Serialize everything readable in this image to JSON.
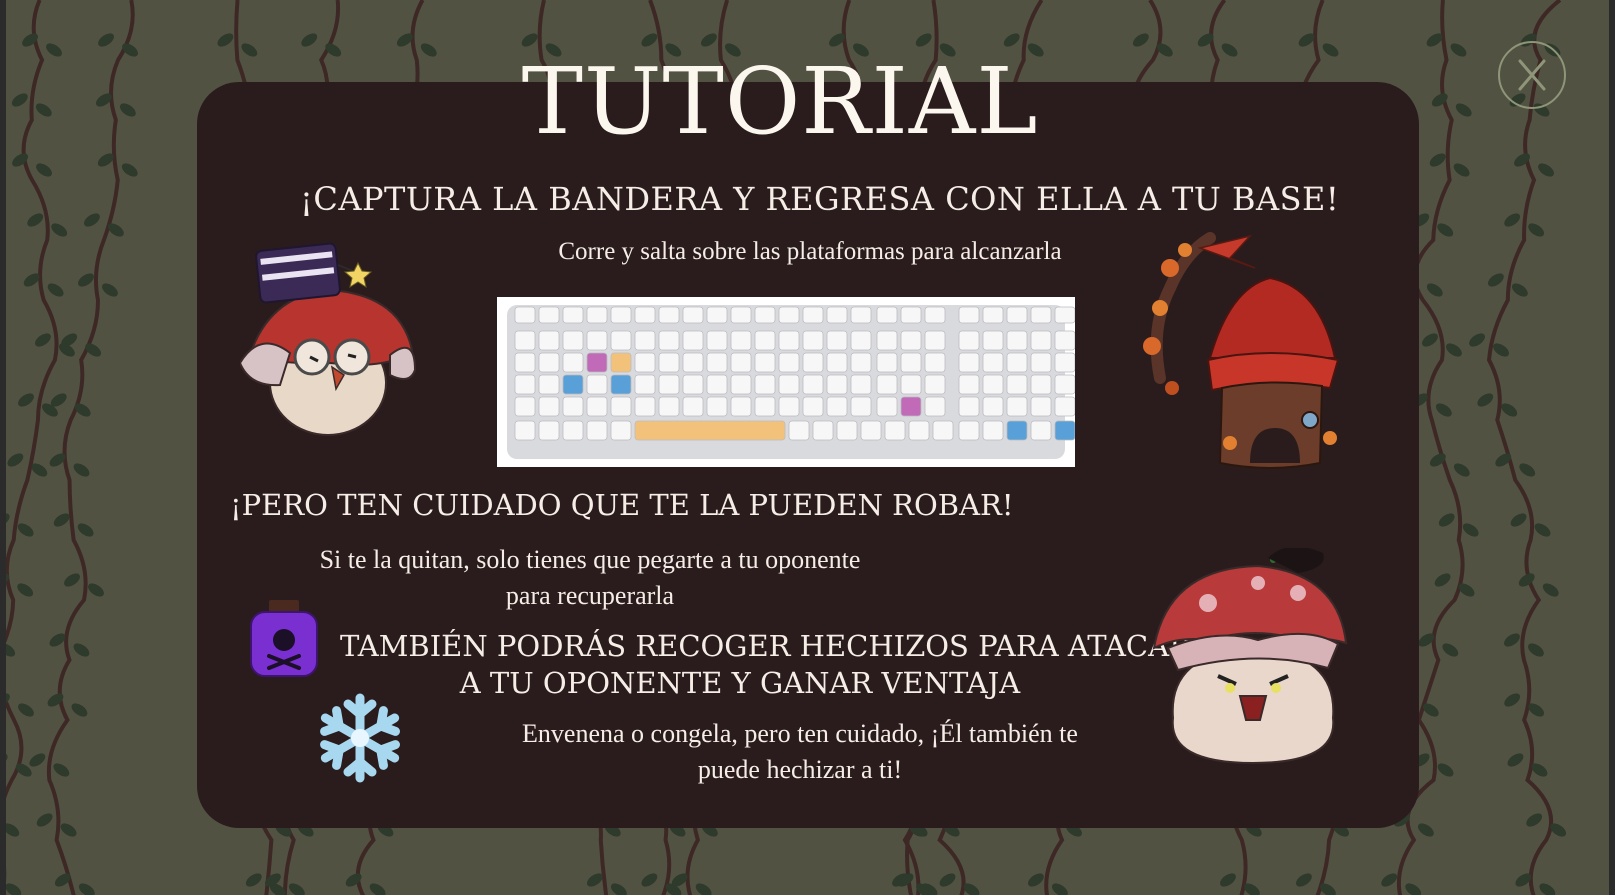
{
  "screen": {
    "title": "TUTORIAL",
    "heading_capture": "¡CAPTURA LA BANDERA Y REGRESA CON ELLA A TU BASE!",
    "text_capture": "Corre y salta sobre las plataformas para alcanzarla",
    "heading_steal": "¡PERO TEN CUIDADO QUE TE LA PUEDEN ROBAR!",
    "text_steal_line1": "Si te la quitan, solo tienes que pegarte a tu oponente",
    "text_steal_line2": "para recuperarla",
    "heading_spells_line1": "TAMBIÉN PODRÁS RECOGER HECHIZOS PARA ATACAR",
    "heading_spells_line2": "A TU OPONENTE Y GANAR VENTAJA",
    "text_spells_line1": "Envenena o congela, pero ten cuidado, ¡Él también te",
    "text_spells_line2": "puede hechizar a ti!"
  },
  "icons": {
    "close": "close-icon",
    "keyboard": "keyboard-diagram",
    "wizard": "mushroom-wizard-character",
    "base": "mushroom-house-base",
    "flag": "flag-branch",
    "poison": "poison-bottle-icon",
    "freeze": "snowflake-icon",
    "opponent": "angry-mushroom-character"
  },
  "colors": {
    "panel": "#2a1c1d",
    "text": "#f6eee6",
    "forest": "#4e4f3f",
    "leaf": "#2f3b2d",
    "accent_poison": "#7a2fd1",
    "accent_freeze": "#a8d8f0",
    "key_blue": "#5aa0d8",
    "key_orange": "#f2c27a",
    "key_pink": "#c06ab8"
  }
}
